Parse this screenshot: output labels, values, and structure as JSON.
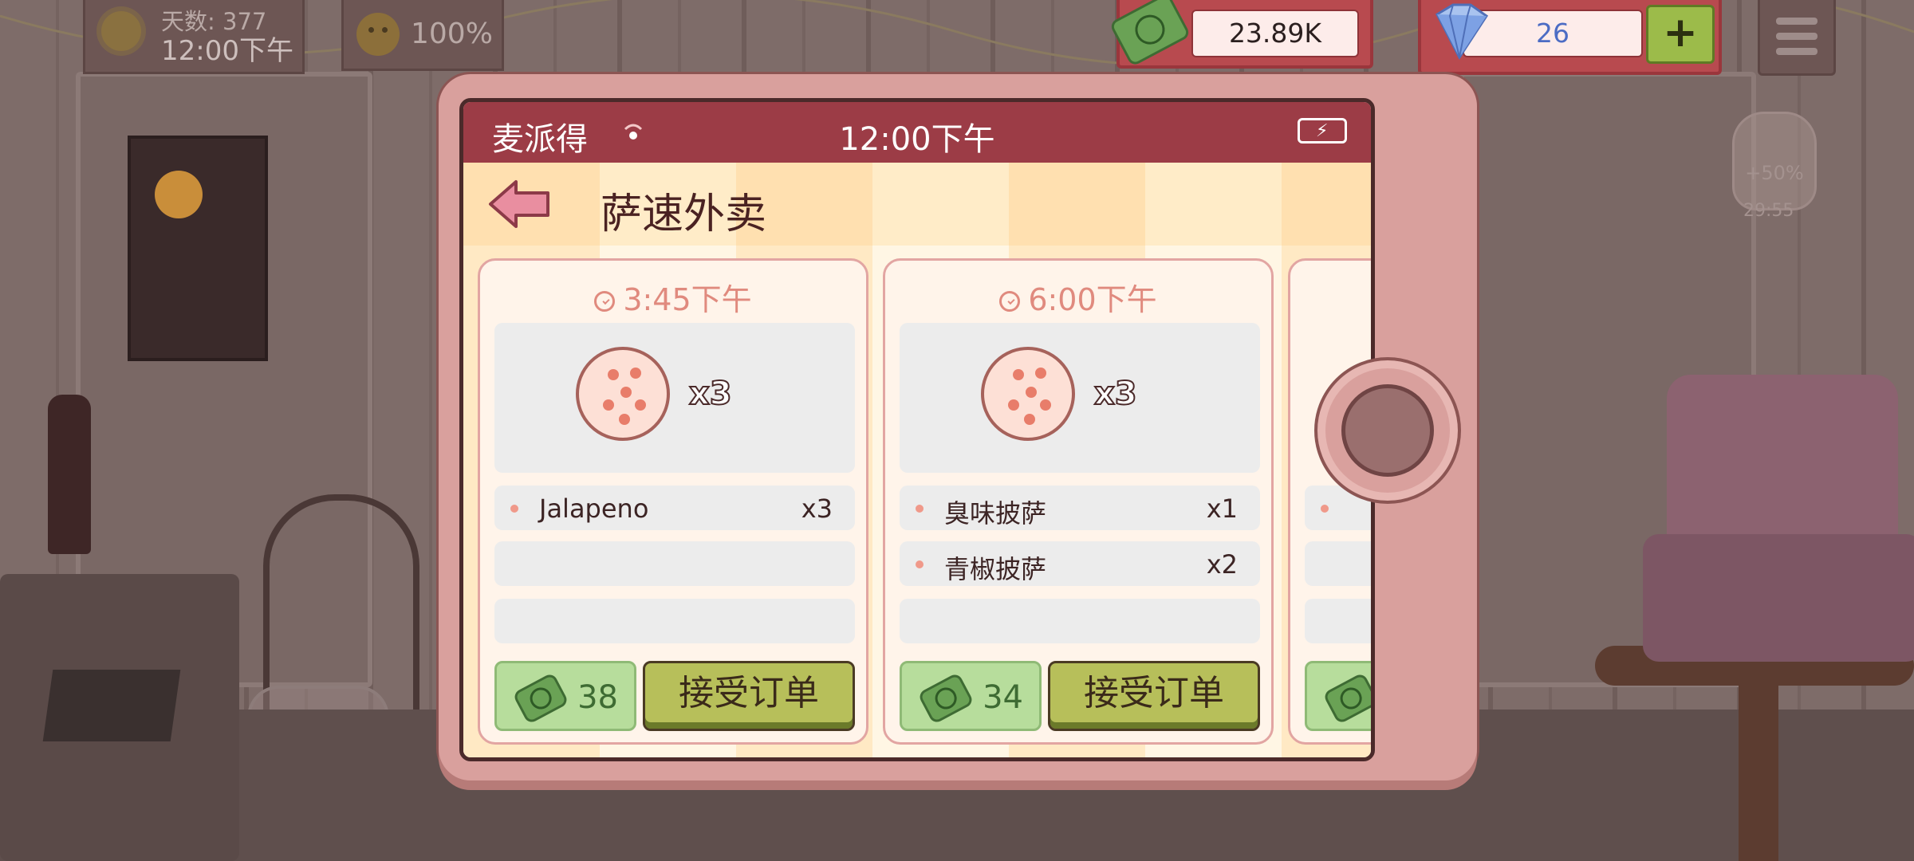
{
  "hud": {
    "day_label": "天数: 377",
    "day_time": "12:00下午",
    "mood_percent": "100%",
    "cash": "23.89K",
    "gems": "26",
    "gems_add": "+",
    "boost_label": "+50%",
    "boost_timer": "29:55"
  },
  "phone": {
    "status": {
      "carrier": "麦派得",
      "clock": "12:00下午"
    },
    "app_title": "萨速外卖",
    "orders": [
      {
        "time": "3:45下午",
        "quantity": "x3",
        "items": [
          {
            "name": "Jalapeno",
            "qty": "x3"
          }
        ],
        "reward": "38",
        "accept_label": "接受订单"
      },
      {
        "time": "6:00下午",
        "quantity": "x3",
        "items": [
          {
            "name": "臭味披萨",
            "qty": "x1"
          },
          {
            "name": "青椒披萨",
            "qty": "x2"
          }
        ],
        "reward": "34",
        "accept_label": "接受订单"
      }
    ]
  },
  "colors": {
    "status_bar": "#9c3c46",
    "phone_frame": "#d9a09d",
    "accept_button": "#b7bf5a",
    "reward_bg": "#b7dd9c",
    "time_text": "#e08a7e"
  }
}
